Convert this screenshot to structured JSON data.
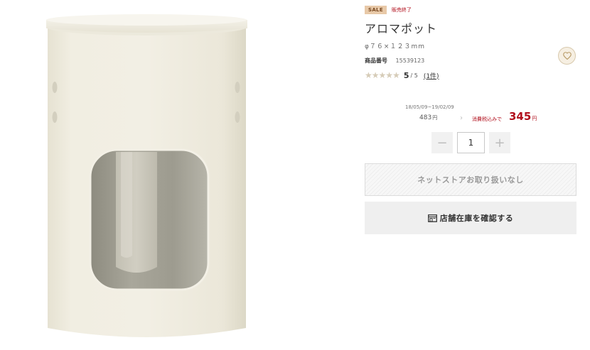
{
  "product": {
    "sale_badge": "SALE",
    "status": "販売終了",
    "title": "アロマポット",
    "size": "φ７６×１２３mm",
    "number_label": "商品番号",
    "number_value": "15539123",
    "rating": {
      "stars_filled": 5,
      "stars_total": 5,
      "score": "5",
      "max": "/ 5",
      "reviews": "(1件)"
    }
  },
  "price": {
    "period": "18/05/09~19/02/09",
    "old_price": "483",
    "yen": "円",
    "arrow": "›",
    "tax_label": "消費税込みで",
    "new_price": "345"
  },
  "quantity": {
    "minus": "−",
    "value": "1",
    "plus": "+"
  },
  "buttons": {
    "cart_unavailable": "ネットストアお取り扱いなし",
    "check_store_stock": "店舗在庫を確認する"
  },
  "icons": {
    "favorite": "heart-icon",
    "store": "store-icon"
  },
  "colors": {
    "sale_badge_bg": "#e8c9a8",
    "accent_red": "#b10f1c",
    "favorite_bg": "#f6efe2"
  }
}
